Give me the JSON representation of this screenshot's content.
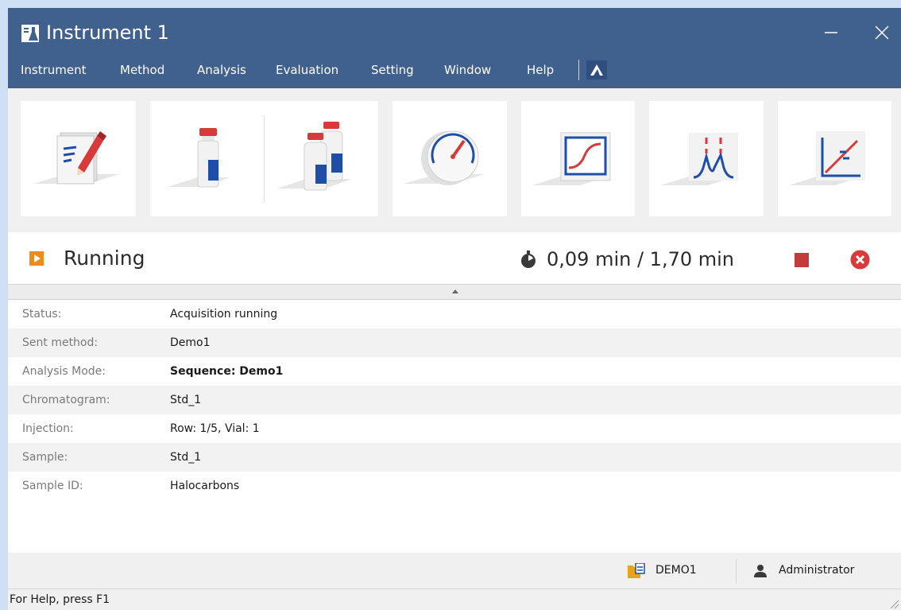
{
  "window": {
    "title": "Instrument 1"
  },
  "menu": {
    "items": [
      {
        "label": "Instrument"
      },
      {
        "label": "Method"
      },
      {
        "label": "Analysis"
      },
      {
        "label": "Evaluation"
      },
      {
        "label": "Setting"
      },
      {
        "label": "Window"
      },
      {
        "label": "Help"
      }
    ]
  },
  "toolbar": {
    "buttons": [
      {
        "icon": "method-edit-icon"
      },
      {
        "icon": "single-run-icon"
      },
      {
        "icon": "sequence-run-icon"
      },
      {
        "icon": "device-monitor-icon"
      },
      {
        "icon": "data-acquisition-icon"
      },
      {
        "icon": "chromatogram-icon"
      },
      {
        "icon": "calibration-icon"
      }
    ]
  },
  "run_status": {
    "state": "Running",
    "time": "0,09 min / 1,70 min"
  },
  "details": [
    {
      "label": "Status:",
      "value": "Acquisition running",
      "bold": false
    },
    {
      "label": "Sent method:",
      "value": "Demo1",
      "bold": false
    },
    {
      "label": "Analysis Mode:",
      "value": "Sequence: Demo1",
      "bold": true
    },
    {
      "label": "Chromatogram:",
      "value": "Std_1",
      "bold": false
    },
    {
      "label": "Injection:",
      "value": "Row: 1/5, Vial: 1",
      "bold": false
    },
    {
      "label": "Sample:",
      "value": "Std_1",
      "bold": false
    },
    {
      "label": "Sample ID:",
      "value": "Halocarbons",
      "bold": false
    }
  ],
  "info": {
    "project": "DEMO1",
    "user": "Administrator"
  },
  "help_bar": "For Help, press F1",
  "colors": {
    "titlebar": "#40608e",
    "accent_orange": "#f08a1c",
    "stop_red": "#c43b3b",
    "abort_red": "#d93a3a",
    "icon_blue": "#1f4ea6"
  }
}
